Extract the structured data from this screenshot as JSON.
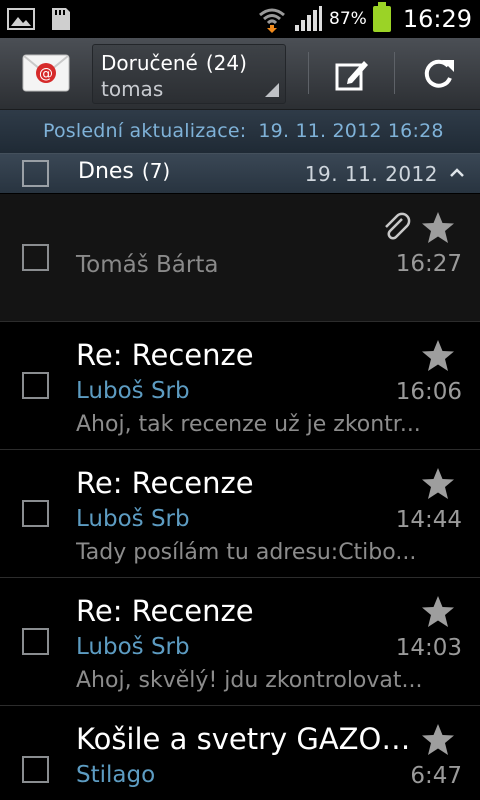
{
  "status_bar": {
    "battery_percent": "87%",
    "time": "16:29",
    "icons": [
      "gallery-icon",
      "sd-card-icon",
      "wifi-icon",
      "signal-icon",
      "battery-icon"
    ]
  },
  "action_bar": {
    "folder_name": "Doručené",
    "folder_count": "(24)",
    "account": "tomas",
    "buttons": [
      "compose-icon",
      "refresh-icon"
    ]
  },
  "update_bar": {
    "label": "Poslední aktualizace:",
    "datetime": "19. 11. 2012 16:28"
  },
  "group": {
    "title": "Dnes",
    "count": "(7)",
    "date": "19. 11. 2012"
  },
  "messages": [
    {
      "subject": "",
      "from": "Tomáš Bárta",
      "time": "16:27",
      "preview": "",
      "attachment": true
    },
    {
      "subject": "Re: Recenze",
      "from": "Luboš Srb",
      "time": "16:06",
      "preview": "Ahoj, tak recenze už je zkontr..."
    },
    {
      "subject": "Re: Recenze",
      "from": "Luboš Srb",
      "time": "14:44",
      "preview": "Tady posílám tu adresu:Ctibo..."
    },
    {
      "subject": "Re: Recenze",
      "from": "Luboš Srb",
      "time": "14:03",
      "preview": "Ahoj, skvělý! jdu zkontrolovat..."
    },
    {
      "subject": "Košile a svetry GAZOI...",
      "from": "Stilago",
      "time": "6:47",
      "preview": ""
    }
  ],
  "colors": {
    "sender_blue": "#5d9cc2",
    "update_text": "#7fb2d8",
    "battery_green": "#9bd326"
  }
}
